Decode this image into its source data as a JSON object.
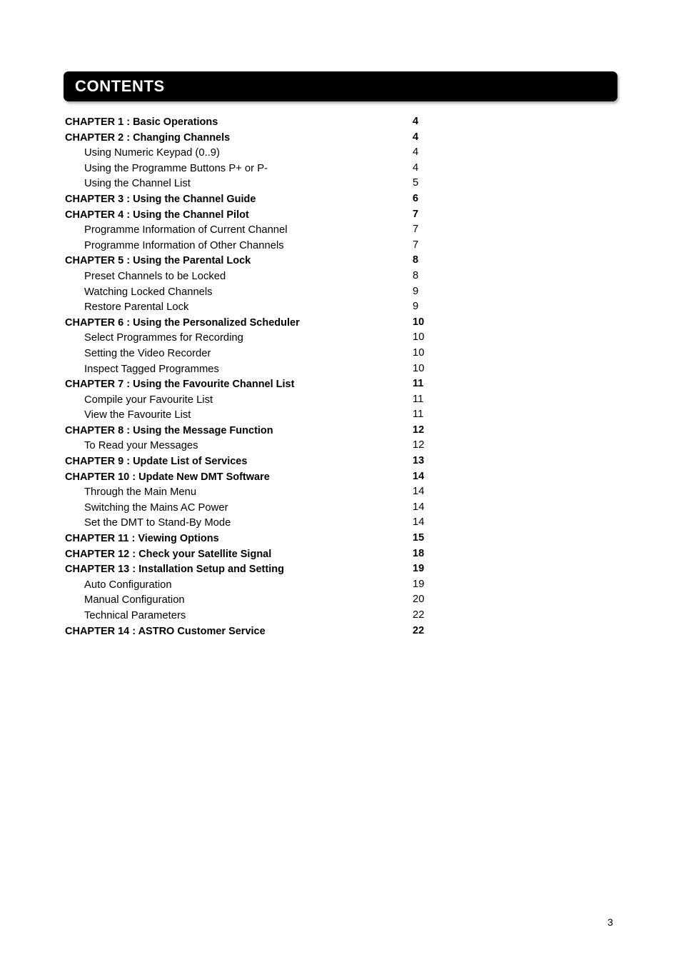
{
  "document": {
    "banner_title": "CONTENTS",
    "page_number": "3"
  },
  "toc": {
    "entries": [
      {
        "level": "chapter",
        "label": "CHAPTER 1 : Basic Operations",
        "page": "4"
      },
      {
        "level": "chapter",
        "label": "CHAPTER 2 : Changing Channels",
        "page": "4"
      },
      {
        "level": "sub",
        "label": "Using Numeric Keypad (0..9)",
        "page": "4"
      },
      {
        "level": "sub",
        "label": "Using the Programme Buttons P+ or P-",
        "page": "4"
      },
      {
        "level": "sub",
        "label": "Using the Channel List",
        "page": "5"
      },
      {
        "level": "chapter",
        "label": "CHAPTER 3 : Using the Channel Guide",
        "page": "6"
      },
      {
        "level": "chapter",
        "label": "CHAPTER 4 : Using the Channel Pilot",
        "page": "7"
      },
      {
        "level": "sub",
        "label": "Programme Information of Current Channel",
        "page": "7"
      },
      {
        "level": "sub",
        "label": "Programme Information of Other Channels",
        "page": "7"
      },
      {
        "level": "chapter",
        "label": "CHAPTER 5 : Using the Parental Lock",
        "page": "8"
      },
      {
        "level": "sub",
        "label": "Preset Channels to be Locked",
        "page": "8"
      },
      {
        "level": "sub",
        "label": "Watching Locked Channels",
        "page": "9"
      },
      {
        "level": "sub",
        "label": "Restore Parental Lock",
        "page": "9"
      },
      {
        "level": "chapter",
        "label": "CHAPTER 6 : Using the Personalized Scheduler",
        "page": "10"
      },
      {
        "level": "sub",
        "label": "Select Programmes for Recording",
        "page": "10"
      },
      {
        "level": "sub",
        "label": "Setting the Video Recorder",
        "page": "10"
      },
      {
        "level": "sub",
        "label": "Inspect Tagged Programmes",
        "page": "10"
      },
      {
        "level": "chapter",
        "label": "CHAPTER 7 : Using the Favourite Channel List",
        "page": "11"
      },
      {
        "level": "sub",
        "label": "Compile your Favourite List",
        "page": "11"
      },
      {
        "level": "sub",
        "label": "View the Favourite List",
        "page": "11"
      },
      {
        "level": "chapter",
        "label": "CHAPTER 8 : Using the Message Function",
        "page": "12"
      },
      {
        "level": "sub",
        "label": "To Read your Messages",
        "page": "12"
      },
      {
        "level": "chapter",
        "label": "CHAPTER 9 : Update List of Services",
        "page": "13"
      },
      {
        "level": "chapter",
        "label": "CHAPTER 10 : Update New DMT Software",
        "page": "14"
      },
      {
        "level": "sub",
        "label": "Through the Main Menu",
        "page": "14"
      },
      {
        "level": "sub",
        "label": "Switching the Mains AC Power",
        "page": "14"
      },
      {
        "level": "sub",
        "label": "Set the DMT to Stand-By Mode",
        "page": "14"
      },
      {
        "level": "chapter",
        "label": "CHAPTER 11 : Viewing Options",
        "page": "15"
      },
      {
        "level": "chapter",
        "label": "CHAPTER 12 : Check your Satellite Signal",
        "page": "18"
      },
      {
        "level": "chapter",
        "label": "CHAPTER 13 : Installation Setup and Setting",
        "page": "19"
      },
      {
        "level": "sub",
        "label": "Auto Configuration",
        "page": "19"
      },
      {
        "level": "sub",
        "label": "Manual Configuration",
        "page": "20"
      },
      {
        "level": "sub",
        "label": "Technical Parameters",
        "page": "22"
      },
      {
        "level": "chapter",
        "label": "CHAPTER 14 : ASTRO Customer Service",
        "page": "22"
      }
    ]
  }
}
